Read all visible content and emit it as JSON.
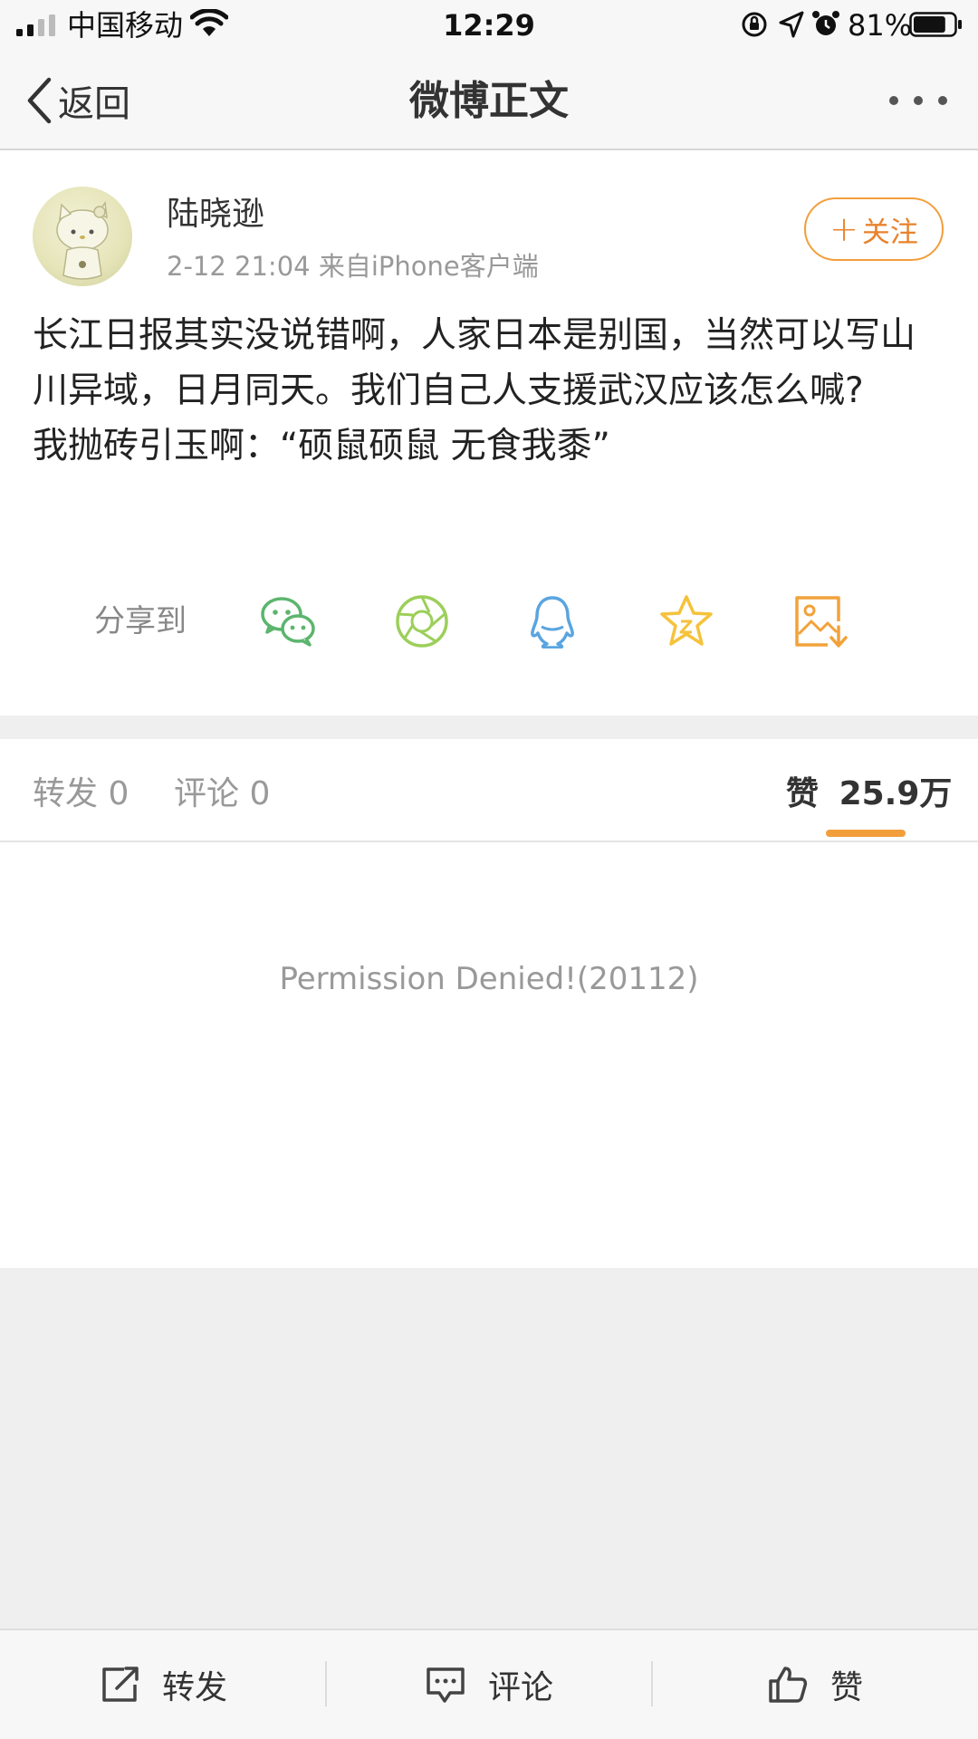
{
  "status_bar": {
    "carrier": "中国移动",
    "time": "12:29",
    "battery_percent": "81%",
    "battery_level": 0.81
  },
  "nav": {
    "back_label": "返回",
    "title": "微博正文"
  },
  "post": {
    "username": "陆晓逊",
    "meta": "2-12 21:04  来自iPhone客户端",
    "follow_label": "关注",
    "text_lines": [
      "长江日报其实没说错啊，人家日本是别国，当然可以写山川异域，日月同天。我们自己人支援武汉应该怎么喊?",
      "我抛砖引玉啊：“硕鼠硕鼠 无食我黍”"
    ]
  },
  "share": {
    "label": "分享到",
    "targets": [
      "wechat-icon",
      "moments-icon",
      "qq-icon",
      "favorite-icon",
      "save-image-icon"
    ],
    "colors": {
      "wechat": "#5cb56e",
      "moments": "#9ccf5a",
      "qq": "#5aa5e0",
      "favorite": "#f5c23a",
      "save": "#f2a23a"
    }
  },
  "tabs": {
    "repost": "转发 0",
    "comment": "评论 0",
    "like_prefix": "赞",
    "like_count": "25.9万",
    "accent": "#f29e3b"
  },
  "content": {
    "error": "Permission Denied!(20112)"
  },
  "toolbar": {
    "repost": "转发",
    "comment": "评论",
    "like": "赞"
  }
}
